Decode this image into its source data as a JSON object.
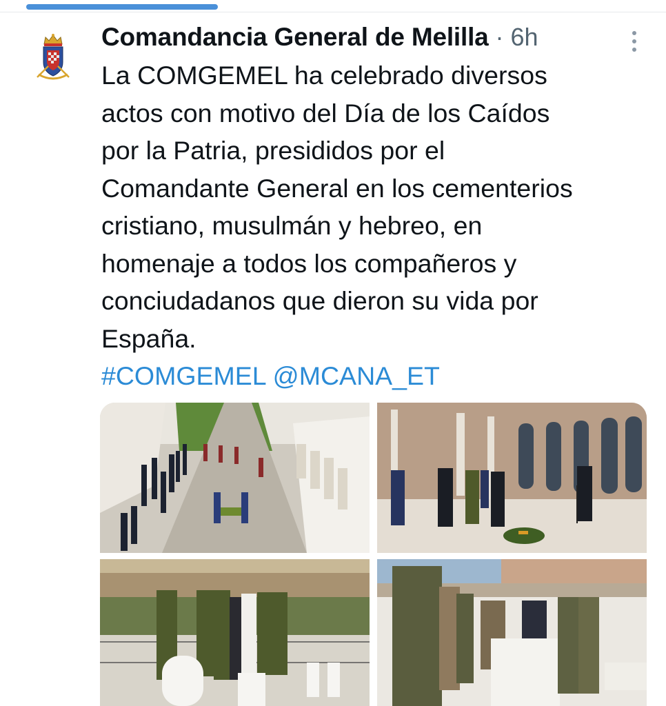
{
  "tweet": {
    "author": "Comandancia General de Melilla",
    "time": "· 6h",
    "text_lines": [
      "La COMGEMEL ha celebrado diversos",
      "actos con motivo del Día de los Caídos",
      "por la Patria, presididos por el",
      "Comandante General en los cementerios",
      "cristiano, musulmán y hebreo, en",
      "homenaje a todos los compañeros y",
      "conciudadanos que dieron su vida por",
      "España."
    ],
    "hashtag": "#COMGEMEL",
    "mention": "@MCANA_ET"
  },
  "icons": {
    "avatar": "coat-of-arms-icon",
    "more": "more-vertical-icon"
  },
  "colors": {
    "accent": "#2b8bd6",
    "progress": "#4a90d9",
    "muted": "#536471",
    "text": "#0f1419"
  }
}
